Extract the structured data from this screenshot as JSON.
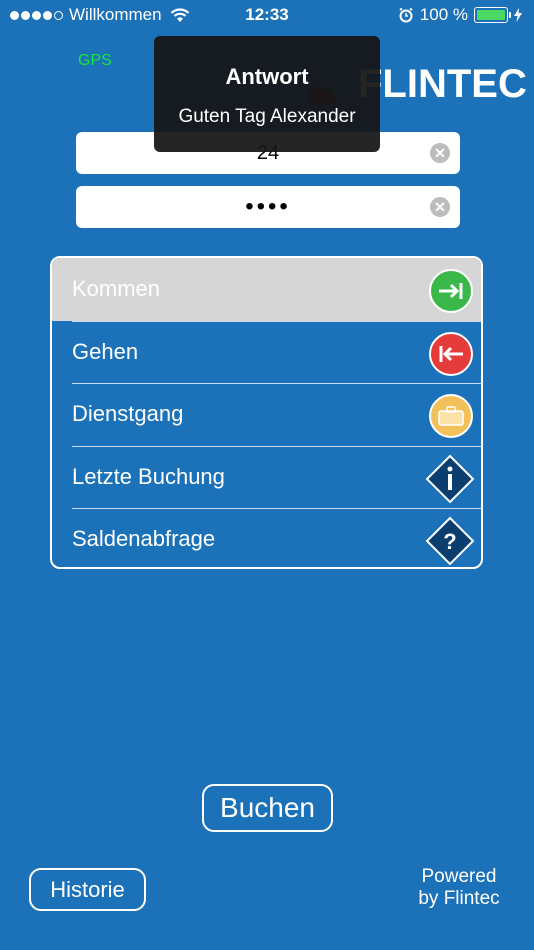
{
  "status_bar": {
    "carrier": "Willkommen",
    "time": "12:33",
    "battery_percent": "100 %",
    "icons": [
      "signal-dots",
      "wifi-icon",
      "alarm-icon",
      "battery-icon",
      "charging-bolt-icon"
    ]
  },
  "gps_label": "GPS",
  "logo_text": "FLINTEC",
  "toast": {
    "title": "Antwort",
    "message": "Guten Tag Alexander"
  },
  "inputs": {
    "user_value": "24",
    "password_value": "••••"
  },
  "menu": {
    "items": [
      {
        "label": "Kommen",
        "icon": "arrow-right-to-bar-icon",
        "selected": true
      },
      {
        "label": "Gehen",
        "icon": "arrow-left-from-bar-icon"
      },
      {
        "label": "Dienstgang",
        "icon": "briefcase-icon"
      },
      {
        "label": "Letzte Buchung",
        "icon": "info-icon"
      },
      {
        "label": "Saldenabfrage",
        "icon": "question-icon"
      }
    ]
  },
  "buttons": {
    "buchen": "Buchen",
    "historie": "Historie"
  },
  "footer": {
    "powered_line1": "Powered",
    "powered_line2": "by Flintec"
  },
  "colors": {
    "background": "#1c72b8",
    "gps": "#19e43a",
    "selected_row": "#d6d6d6",
    "kommen_icon": "#3bb84a",
    "gehen_icon": "#e53b3b",
    "dienstgang_icon": "#f3c15a",
    "diamond_icon": "#0b3d6e"
  }
}
